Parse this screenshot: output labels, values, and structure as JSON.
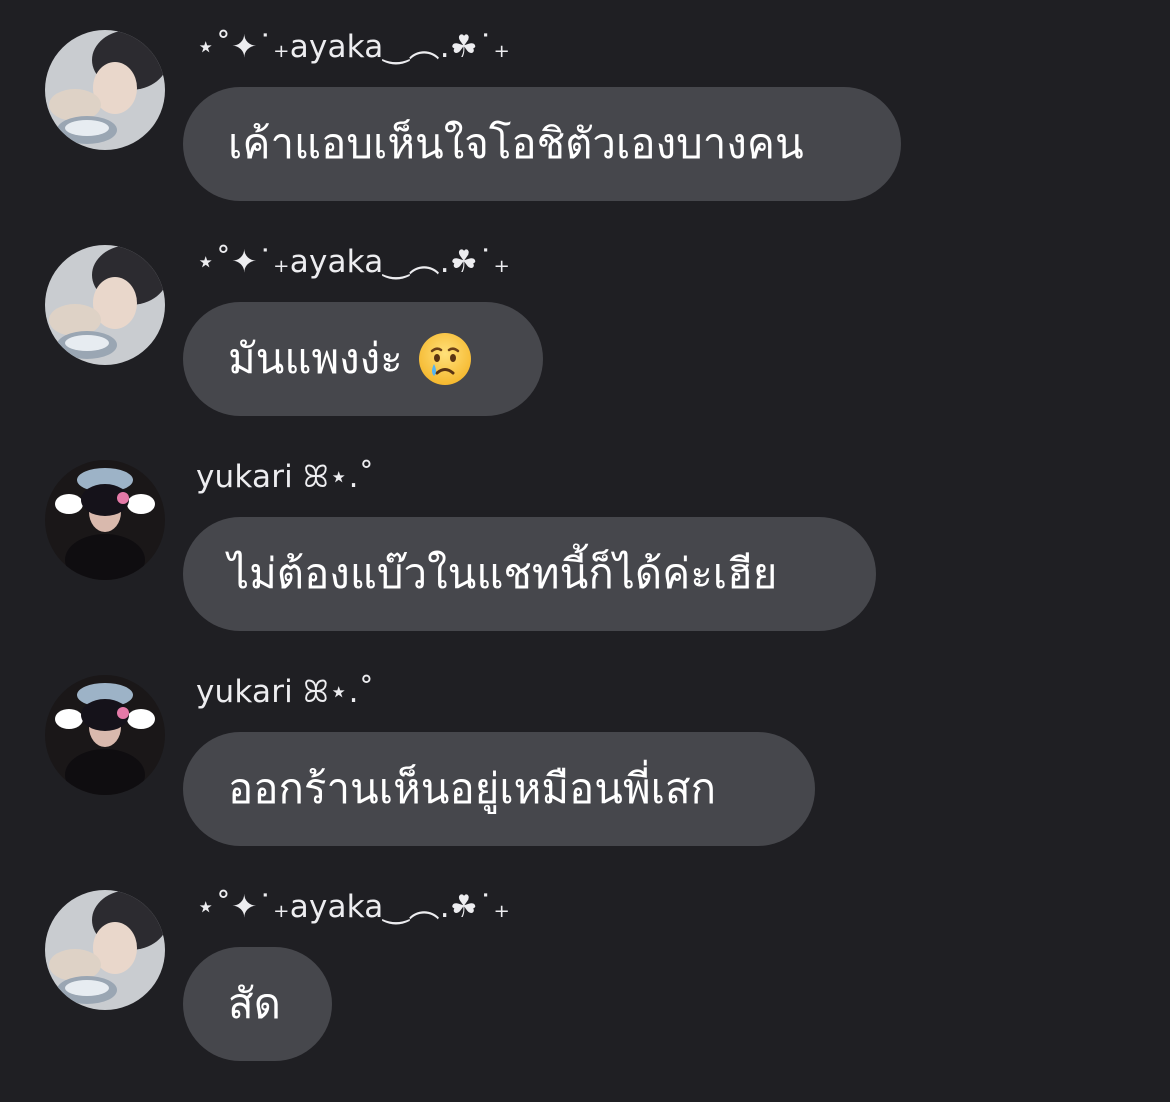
{
  "messages": [
    {
      "sender": "⋆˚✦˙₊ayaka‿︵.☘˙₊",
      "text": "เค้าแอบเห็นใจโอชิตัวเองบางคน",
      "avatar": "avatar-ayaka"
    },
    {
      "sender": "⋆˚✦˙₊ayaka‿︵.☘˙₊",
      "text": "มันแพงง่ะ",
      "emoji": "crying-face-icon",
      "avatar": "avatar-ayaka"
    },
    {
      "sender": "yukari ꕤ⋆.˚",
      "text": "ไม่ต้องแบ๊วในแชทนี้ก็ได้ค่ะเฮีย",
      "avatar": "avatar-yukari"
    },
    {
      "sender": "yukari ꕤ⋆.˚",
      "text": "ออกร้านเห็นอยู่เหมือนพี่เสก",
      "avatar": "avatar-yukari"
    },
    {
      "sender": "⋆˚✦˙₊ayaka‿︵.☘˙₊",
      "text": "สัด",
      "avatar": "avatar-ayaka"
    }
  ],
  "colors": {
    "background": "#1f1f23",
    "bubble": "#46474c",
    "text": "#ffffff"
  }
}
